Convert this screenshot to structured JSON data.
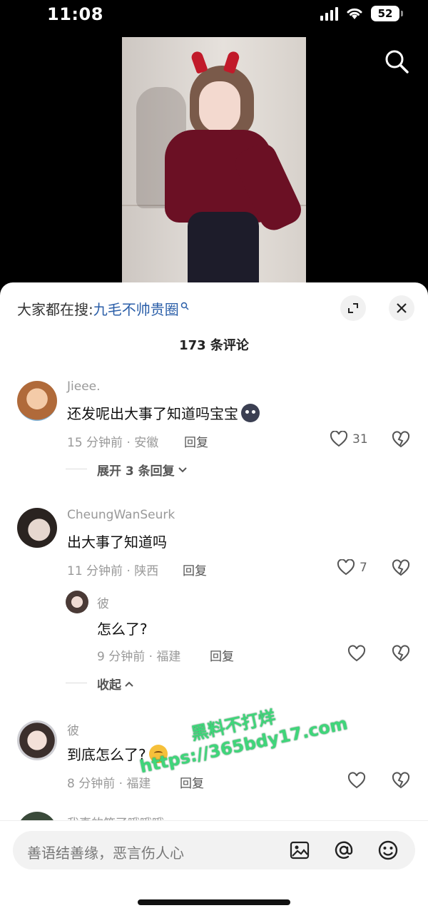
{
  "status_bar": {
    "time": "11:08",
    "battery": "52"
  },
  "trend": {
    "prefix": "大家都在搜: ",
    "query": "九毛不帅贵圈"
  },
  "comments_header": {
    "count_label": "173 条评论"
  },
  "comments": [
    {
      "username": "Jieee.",
      "text": "还发呢出大事了知道吗宝宝",
      "emoji": "dark-face-emoji",
      "meta": "15 分钟前 · 安徽",
      "reply_label": "回复",
      "likes": "31",
      "thread_label": "展开 3 条回复"
    },
    {
      "username": "CheungWanSeurk",
      "text": "出大事了知道吗",
      "meta": "11 分钟前 · 陕西",
      "reply_label": "回复",
      "likes": "7"
    }
  ],
  "nested_reply": {
    "username": "彼",
    "text": "怎么了?",
    "meta": "9 分钟前 · 福建",
    "reply_label": "回复",
    "collapse_label": "收起"
  },
  "third_comment": {
    "username": "彼",
    "text": "到底怎么了?",
    "emoji": "worried-face-emoji",
    "meta": "8 分钟前 · 福建",
    "reply_label": "回复"
  },
  "partial_comment": {
    "username": "我真的笑了哦哦哦"
  },
  "watermark": {
    "line1": "黑料不打烊",
    "line2": "https://365bdy17.com"
  },
  "input": {
    "placeholder": "善语结善缘，恶言伤人心"
  },
  "icons": [
    "search-icon",
    "expand-icon",
    "close-icon",
    "heart-icon",
    "broken-heart-icon",
    "chevron-down-icon",
    "chevron-up-icon",
    "image-icon",
    "at-icon",
    "emoji-icon"
  ],
  "colors": {
    "link": "#2a5ea8",
    "watermark": "#3fd67a",
    "sheet_bg": "#ffffff",
    "page_bg": "#000000"
  }
}
